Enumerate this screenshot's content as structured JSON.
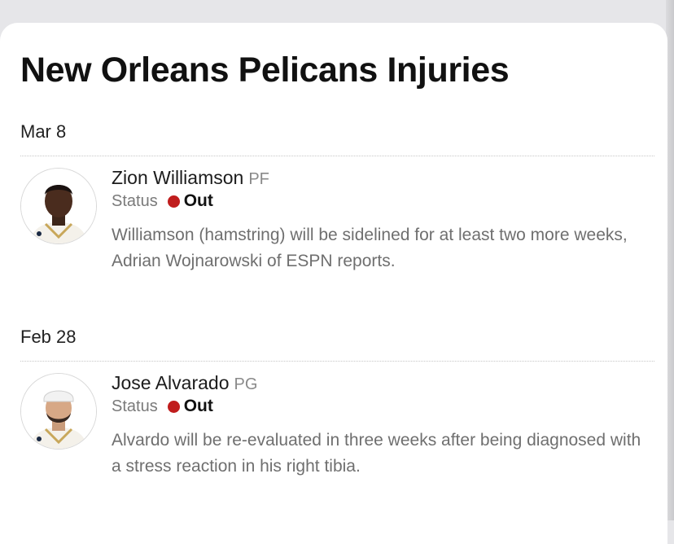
{
  "page": {
    "title": "New Orleans Pelicans Injuries"
  },
  "injuries": [
    {
      "date": "Mar 8",
      "player": "Zion Williamson",
      "position": "PF",
      "status_label": "Status",
      "status_value": "Out",
      "status_color": "#c01d1d",
      "note": "Williamson (hamstring) will be sidelined for at least two more weeks, Adrian Wojnarowski of ESPN reports.",
      "avatar_icon": "player-headshot-icon"
    },
    {
      "date": "Feb 28",
      "player": "Jose Alvarado",
      "position": "PG",
      "status_label": "Status",
      "status_value": "Out",
      "status_color": "#c01d1d",
      "note": "Alvardo will be re-evaluated in three weeks after being diagnosed with a stress reaction in his right tibia.",
      "avatar_icon": "player-headshot-icon"
    }
  ]
}
